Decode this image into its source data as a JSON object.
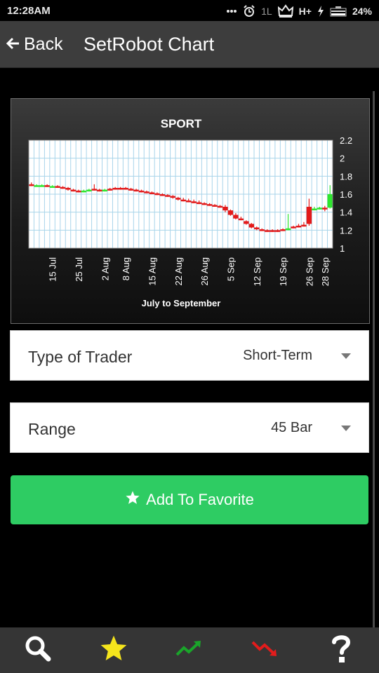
{
  "status": {
    "time": "12:28AM",
    "network": "H+",
    "signal_mark": "1L",
    "battery": "24%",
    "icons": [
      "overflow-dots-icon",
      "alarm-icon",
      "signal-icon",
      "crown-icon",
      "network-icon",
      "charging-icon",
      "battery-icon"
    ]
  },
  "header": {
    "back_label": "Back",
    "title": "SetRobot Chart"
  },
  "chart_data": {
    "type": "candlestick",
    "title": "SPORT",
    "xlabel": "July to September",
    "ylabel": "",
    "ylim": [
      1,
      2.2
    ],
    "y_ticks": [
      "2.2",
      "2",
      "1.8",
      "1.6",
      "1.4",
      "1.2",
      "1"
    ],
    "x_ticks": [
      "15 Jul",
      "25 Jul",
      "2 Aug",
      "8 Aug",
      "15 Aug",
      "22 Aug",
      "26 Aug",
      "5 Sep",
      "12 Sep",
      "19 Sep",
      "26 Sep",
      "28 Sep"
    ],
    "x_tick_bars": [
      4,
      9,
      14,
      18,
      23,
      28,
      33,
      38,
      43,
      48,
      53,
      56
    ],
    "bars": 58,
    "grid": true,
    "series": [
      {
        "values": [
          [
            1.71,
            1.73,
            1.69,
            1.7
          ],
          [
            1.7,
            1.71,
            1.69,
            1.7
          ],
          [
            1.7,
            1.71,
            1.69,
            1.7
          ],
          [
            1.7,
            1.71,
            1.68,
            1.69
          ],
          [
            1.69,
            1.7,
            1.68,
            1.69
          ],
          [
            1.69,
            1.7,
            1.67,
            1.68
          ],
          [
            1.68,
            1.69,
            1.66,
            1.67
          ],
          [
            1.67,
            1.68,
            1.64,
            1.65
          ],
          [
            1.65,
            1.66,
            1.63,
            1.64
          ],
          [
            1.64,
            1.65,
            1.62,
            1.63
          ],
          [
            1.63,
            1.65,
            1.62,
            1.64
          ],
          [
            1.64,
            1.66,
            1.63,
            1.65
          ],
          [
            1.66,
            1.71,
            1.64,
            1.65
          ],
          [
            1.65,
            1.66,
            1.63,
            1.64
          ],
          [
            1.64,
            1.66,
            1.63,
            1.65
          ],
          [
            1.66,
            1.67,
            1.64,
            1.65
          ],
          [
            1.67,
            1.68,
            1.65,
            1.66
          ],
          [
            1.67,
            1.68,
            1.65,
            1.66
          ],
          [
            1.67,
            1.68,
            1.65,
            1.66
          ],
          [
            1.66,
            1.67,
            1.64,
            1.65
          ],
          [
            1.65,
            1.66,
            1.63,
            1.64
          ],
          [
            1.64,
            1.65,
            1.62,
            1.63
          ],
          [
            1.63,
            1.64,
            1.61,
            1.62
          ],
          [
            1.62,
            1.63,
            1.6,
            1.61
          ],
          [
            1.61,
            1.62,
            1.59,
            1.6
          ],
          [
            1.6,
            1.61,
            1.58,
            1.59
          ],
          [
            1.59,
            1.6,
            1.57,
            1.58
          ],
          [
            1.58,
            1.59,
            1.55,
            1.56
          ],
          [
            1.56,
            1.57,
            1.53,
            1.54
          ],
          [
            1.54,
            1.56,
            1.52,
            1.53
          ],
          [
            1.53,
            1.55,
            1.51,
            1.52
          ],
          [
            1.52,
            1.54,
            1.5,
            1.51
          ],
          [
            1.51,
            1.53,
            1.49,
            1.5
          ],
          [
            1.5,
            1.51,
            1.48,
            1.49
          ],
          [
            1.49,
            1.5,
            1.47,
            1.48
          ],
          [
            1.48,
            1.49,
            1.46,
            1.47
          ],
          [
            1.47,
            1.48,
            1.45,
            1.46
          ],
          [
            1.46,
            1.48,
            1.4,
            1.42
          ],
          [
            1.42,
            1.43,
            1.36,
            1.37
          ],
          [
            1.37,
            1.39,
            1.32,
            1.33
          ],
          [
            1.33,
            1.35,
            1.31,
            1.32
          ],
          [
            1.3,
            1.31,
            1.26,
            1.27
          ],
          [
            1.27,
            1.28,
            1.22,
            1.23
          ],
          [
            1.23,
            1.24,
            1.2,
            1.21
          ],
          [
            1.21,
            1.22,
            1.19,
            1.2
          ],
          [
            1.2,
            1.21,
            1.18,
            1.19
          ],
          [
            1.2,
            1.21,
            1.18,
            1.19
          ],
          [
            1.2,
            1.21,
            1.18,
            1.19
          ],
          [
            1.21,
            1.22,
            1.19,
            1.2
          ],
          [
            1.22,
            1.38,
            1.2,
            1.22
          ],
          [
            1.24,
            1.25,
            1.22,
            1.23
          ],
          [
            1.25,
            1.27,
            1.23,
            1.24
          ],
          [
            1.26,
            1.29,
            1.24,
            1.25
          ],
          [
            1.46,
            1.55,
            1.25,
            1.27
          ],
          [
            1.43,
            1.46,
            1.42,
            1.44
          ],
          [
            1.44,
            1.46,
            1.43,
            1.45
          ],
          [
            1.45,
            1.47,
            1.41,
            1.44
          ],
          [
            1.45,
            1.7,
            1.44,
            1.6
          ]
        ]
      }
    ],
    "colors": {
      "down": "#e31a1a",
      "up": "#2ee62e",
      "grid": "#a8d4ea",
      "plot_bg": "#ffffff"
    }
  },
  "type_of_trader": {
    "label": "Type of Trader",
    "value": "Short-Term"
  },
  "range": {
    "label": "Range",
    "value": "45 Bar"
  },
  "favorite": {
    "label": "Add To Favorite",
    "icon": "star-icon",
    "color": "#2ecc63"
  },
  "nav": {
    "items": [
      {
        "name": "search",
        "icon": "search-icon"
      },
      {
        "name": "favorites",
        "icon": "star-icon",
        "color": "#f5e51c"
      },
      {
        "name": "up-trend",
        "icon": "trend-up-icon",
        "color": "#1aa52a"
      },
      {
        "name": "down-trend",
        "icon": "trend-down-icon",
        "color": "#e21c1c"
      },
      {
        "name": "help",
        "icon": "help-icon"
      }
    ]
  }
}
